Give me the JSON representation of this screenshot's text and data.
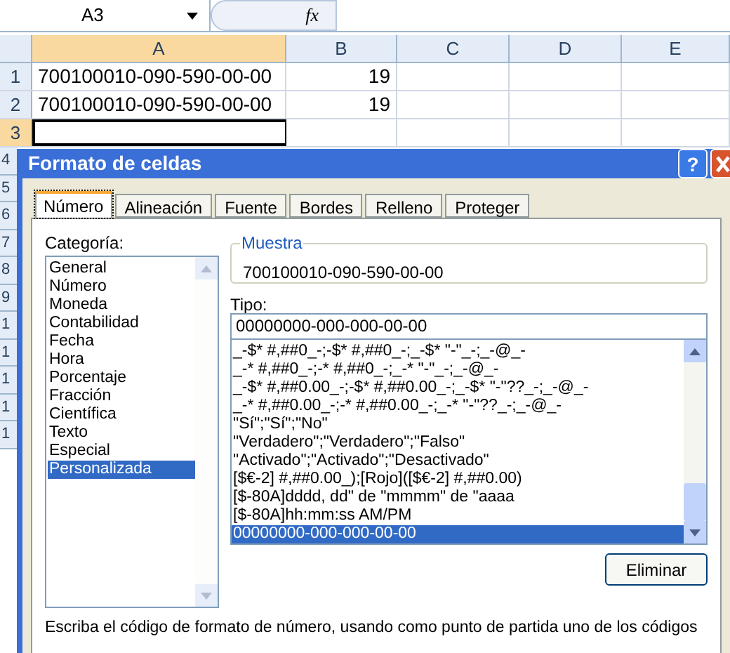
{
  "formula_bar": {
    "name_box": "A3",
    "fx": "fx"
  },
  "sheet": {
    "columns": [
      "A",
      "B",
      "C",
      "D",
      "E"
    ],
    "rows": [
      {
        "number": "1",
        "cells": [
          "700100010-090-590-00-00",
          "19",
          "",
          "",
          ""
        ],
        "selected": false
      },
      {
        "number": "2",
        "cells": [
          "700100010-090-590-00-00",
          "19",
          "",
          "",
          ""
        ],
        "selected": false
      },
      {
        "number": "3",
        "cells": [
          "",
          "",
          "",
          "",
          ""
        ],
        "selected": true
      }
    ],
    "hidden_row_numbers": [
      "4",
      "5",
      "6",
      "7",
      "8",
      "9",
      "1",
      "1",
      "1",
      "1",
      "1"
    ]
  },
  "dialog": {
    "title": "Formato de celdas",
    "tabs": [
      {
        "label": "Número",
        "selected": true
      },
      {
        "label": "Alineación",
        "selected": false
      },
      {
        "label": "Fuente",
        "selected": false
      },
      {
        "label": "Bordes",
        "selected": false
      },
      {
        "label": "Relleno",
        "selected": false
      },
      {
        "label": "Proteger",
        "selected": false
      }
    ],
    "category_label": "Categoría:",
    "categories": [
      {
        "label": "General",
        "selected": false
      },
      {
        "label": "Número",
        "selected": false
      },
      {
        "label": "Moneda",
        "selected": false
      },
      {
        "label": "Contabilidad",
        "selected": false
      },
      {
        "label": "Fecha",
        "selected": false
      },
      {
        "label": "Hora",
        "selected": false
      },
      {
        "label": "Porcentaje",
        "selected": false
      },
      {
        "label": "Fracción",
        "selected": false
      },
      {
        "label": "Científica",
        "selected": false
      },
      {
        "label": "Texto",
        "selected": false
      },
      {
        "label": "Especial",
        "selected": false
      },
      {
        "label": "Personalizada",
        "selected": true
      }
    ],
    "sample_label": "Muestra",
    "sample_value": "700100010-090-590-00-00",
    "type_label": "Tipo:",
    "type_value": "00000000-000-000-00-00",
    "formats": [
      {
        "label": "_-$* #,##0_-;-$* #,##0_-;_-$* \"-\"_-;_-@_-",
        "selected": false
      },
      {
        "label": "_-* #,##0_-;-* #,##0_-;_-* \"-\"_-;_-@_-",
        "selected": false
      },
      {
        "label": "_-$* #,##0.00_-;-$* #,##0.00_-;_-$* \"-\"??_-;_-@_-",
        "selected": false
      },
      {
        "label": "_-* #,##0.00_-;-* #,##0.00_-;_-* \"-\"??_-;_-@_-",
        "selected": false
      },
      {
        "label": "\"Sí\";\"Sí\";\"No\"",
        "selected": false
      },
      {
        "label": "\"Verdadero\";\"Verdadero\";\"Falso\"",
        "selected": false
      },
      {
        "label": "\"Activado\";\"Activado\";\"Desactivado\"",
        "selected": false
      },
      {
        "label": "[$€-2] #,##0.00_);[Rojo]([$€-2] #,##0.00)",
        "selected": false
      },
      {
        "label": "[$-80A]dddd, dd\" de \"mmmm\" de \"aaaa",
        "selected": false
      },
      {
        "label": "[$-80A]hh:mm:ss AM/PM",
        "selected": false
      },
      {
        "label": "00000000-000-000-00-00",
        "selected": true
      }
    ],
    "delete_button": "Eliminar",
    "help": "?",
    "description": "Escriba el código de formato de número, usando como punto de partida uno de los códigos"
  }
}
